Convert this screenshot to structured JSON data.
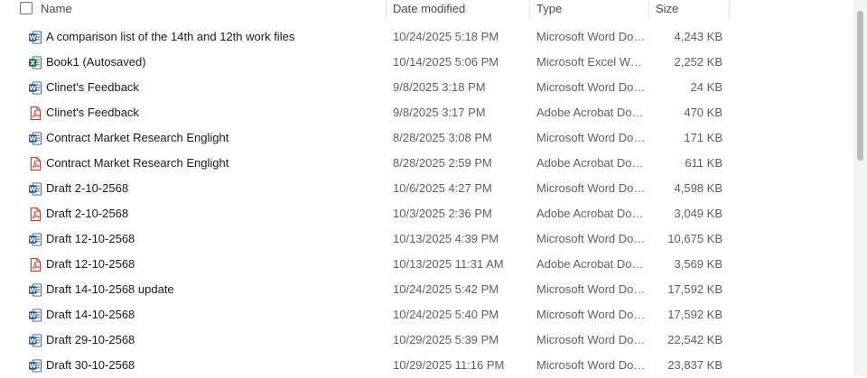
{
  "columns": {
    "name": "Name",
    "date": "Date modified",
    "type": "Type",
    "size": "Size"
  },
  "colors": {
    "word": "#2b579a",
    "excel": "#217346",
    "pdf": "#d93025"
  },
  "files": [
    {
      "name": "A comparison list of the 14th and 12th work files",
      "date": "10/24/2025 5:18 PM",
      "type": "Microsoft Word Doc...",
      "size": "4,243 KB",
      "icon": "word-icon"
    },
    {
      "name": "Book1 (Autosaved)",
      "date": "10/14/2025 5:06 PM",
      "type": "Microsoft Excel Work...",
      "size": "2,252 KB",
      "icon": "excel-icon"
    },
    {
      "name": "Clinet's  Feedback",
      "date": "9/8/2025 3:18 PM",
      "type": "Microsoft Word Doc...",
      "size": "24 KB",
      "icon": "word-icon"
    },
    {
      "name": "Clinet's  Feedback",
      "date": "9/8/2025 3:17 PM",
      "type": "Adobe Acrobat Docu...",
      "size": "470 KB",
      "icon": "pdf-icon"
    },
    {
      "name": "Contract Market Research Englight",
      "date": "8/28/2025 3:08 PM",
      "type": "Microsoft Word Doc...",
      "size": "171 KB",
      "icon": "word-icon"
    },
    {
      "name": "Contract Market Research Englight",
      "date": "8/28/2025 2:59 PM",
      "type": "Adobe Acrobat Docu...",
      "size": "611 KB",
      "icon": "pdf-icon"
    },
    {
      "name": "Draft 2-10-2568",
      "date": "10/6/2025 4:27 PM",
      "type": "Microsoft Word Doc...",
      "size": "4,598 KB",
      "icon": "word-icon"
    },
    {
      "name": "Draft 2-10-2568",
      "date": "10/3/2025 2:36 PM",
      "type": "Adobe Acrobat Docu...",
      "size": "3,049 KB",
      "icon": "pdf-icon"
    },
    {
      "name": "Draft 12-10-2568",
      "date": "10/13/2025 4:39 PM",
      "type": "Microsoft Word Doc...",
      "size": "10,675 KB",
      "icon": "word-icon"
    },
    {
      "name": "Draft 12-10-2568",
      "date": "10/13/2025 11:31 AM",
      "type": "Adobe Acrobat Docu...",
      "size": "3,569 KB",
      "icon": "pdf-icon"
    },
    {
      "name": "Draft 14-10-2568 update",
      "date": "10/24/2025 5:42 PM",
      "type": "Microsoft Word Doc...",
      "size": "17,592 KB",
      "icon": "word-icon"
    },
    {
      "name": "Draft 14-10-2568",
      "date": "10/24/2025 5:40 PM",
      "type": "Microsoft Word Doc...",
      "size": "17,592 KB",
      "icon": "word-icon"
    },
    {
      "name": "Draft 29-10-2568",
      "date": "10/29/2025 5:39 PM",
      "type": "Microsoft Word Doc...",
      "size": "22,542 KB",
      "icon": "word-icon"
    },
    {
      "name": "Draft 30-10-2568",
      "date": "10/29/2025 11:16 PM",
      "type": "Microsoft Word Doc...",
      "size": "23,837 KB",
      "icon": "word-icon"
    }
  ]
}
